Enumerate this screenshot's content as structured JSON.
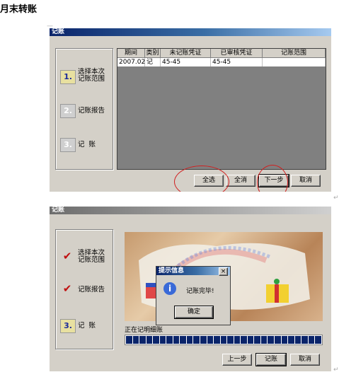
{
  "doc_heading": "月末转账",
  "window1": {
    "title": "记账",
    "steps": [
      {
        "number": "1.",
        "label": "选择本次\n记账范围",
        "state": "active"
      },
      {
        "number": "2.",
        "label": "记账报告",
        "state": "pending"
      },
      {
        "number": "3.",
        "label": "记  账",
        "state": "pending"
      }
    ],
    "table": {
      "headers": [
        "期间",
        "类别",
        "未记账凭证",
        "已审核凭证",
        "记账范围"
      ],
      "rows": [
        [
          "2007.02",
          "记",
          "45-45",
          "45-45",
          ""
        ]
      ]
    },
    "buttons": {
      "select_all": "全选",
      "deselect_all": "全消",
      "next": "下一步",
      "cancel": "取消"
    }
  },
  "window2": {
    "title": "记账",
    "steps": [
      {
        "number": "",
        "label": "选择本次\n记账范围",
        "state": "done"
      },
      {
        "number": "",
        "label": "记账报告",
        "state": "done"
      },
      {
        "number": "3.",
        "label": "记  账",
        "state": "active"
      }
    ],
    "dialog": {
      "title": "提示信息",
      "message": "记账完毕!",
      "ok": "确定",
      "close": "×"
    },
    "progress_label": "正在记明细账",
    "progress_segments": 29,
    "buttons": {
      "prev": "上一步",
      "post": "记账",
      "cancel": "取消"
    }
  },
  "colors": {
    "annotation": "#d02020",
    "titlebar_active": "#0a246a",
    "progress": "#0a246a"
  }
}
